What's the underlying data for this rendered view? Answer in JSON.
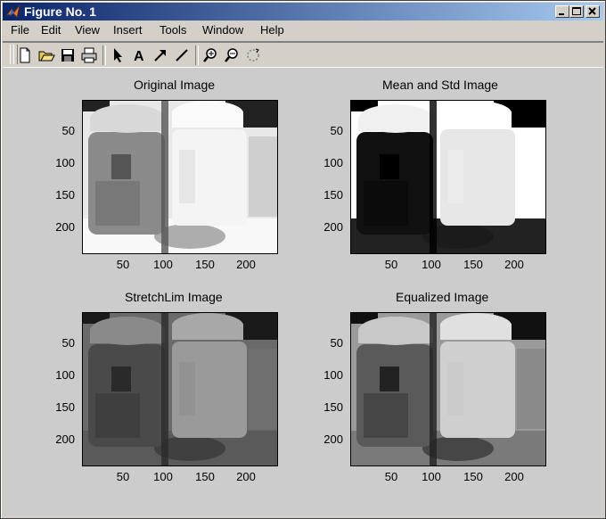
{
  "window": {
    "title": "Figure No. 1"
  },
  "menu": {
    "items": [
      {
        "label": "File"
      },
      {
        "label": "Edit"
      },
      {
        "label": "View"
      },
      {
        "label": "Insert"
      },
      {
        "label": "Tools"
      },
      {
        "label": "Window"
      },
      {
        "label": "Help"
      }
    ]
  },
  "toolbar": {
    "buttons": [
      "new-file-icon",
      "open-folder-icon",
      "save-icon",
      "print-icon",
      "pointer-icon",
      "text-icon",
      "arrow-icon",
      "line-icon",
      "zoom-in-icon",
      "zoom-out-icon",
      "rotate-icon"
    ],
    "text_label": "A"
  },
  "panels": [
    {
      "title": "Original Image",
      "style": "original"
    },
    {
      "title": "Mean and Std Image",
      "style": "meanstd"
    },
    {
      "title": "StretchLim Image",
      "style": "stretch"
    },
    {
      "title": "Equalized Image",
      "style": "equalized"
    }
  ],
  "axes": {
    "yticks": [
      "50",
      "100",
      "150",
      "200"
    ],
    "xticks": [
      "50",
      "100",
      "150",
      "200"
    ]
  },
  "colors": {
    "titlebar_start": "#0a246a",
    "titlebar_end": "#a6caf0",
    "figure_bg": "#cccccc"
  }
}
